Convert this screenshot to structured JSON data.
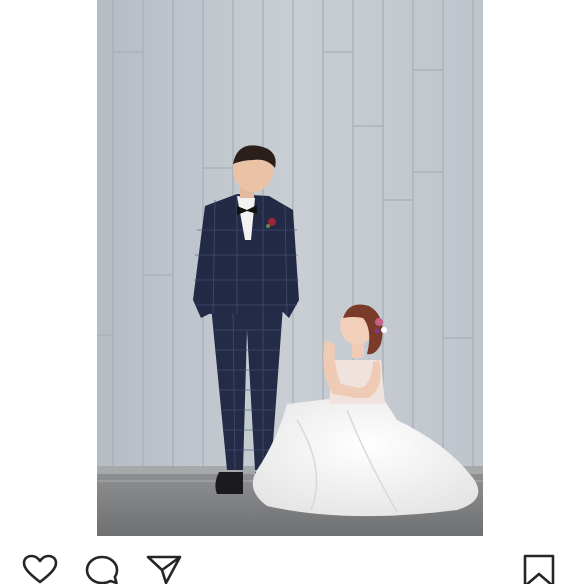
{
  "post": {
    "photo_icon": "wedding-couple-photo"
  },
  "actions": {
    "like_icon": "heart-icon",
    "comment_icon": "comment-bubble-icon",
    "share_icon": "paper-plane-icon",
    "save_icon": "bookmark-icon"
  },
  "colors": {
    "icon_stroke": "#262626",
    "background": "#ffffff",
    "wall": "#c3c9d0",
    "suit": "#232a45",
    "dress": "#f4f3f2"
  }
}
